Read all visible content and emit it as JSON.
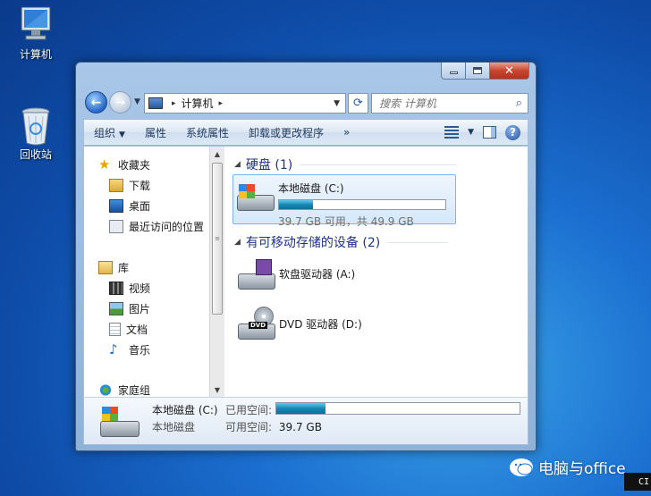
{
  "desktop": {
    "icons": [
      {
        "label": "计算机"
      },
      {
        "label": "回收站"
      }
    ]
  },
  "window": {
    "nav": {
      "back_glyph": "←",
      "forward_glyph": "→",
      "recent_glyph": "▼"
    },
    "address": {
      "path": [
        "计算机"
      ],
      "separator": "▸"
    },
    "refresh_glyph": "⟳",
    "search": {
      "placeholder": "搜索 计算机"
    },
    "toolbar": {
      "organize": "组织",
      "properties": "属性",
      "system_properties": "系统属性",
      "uninstall": "卸载或更改程序",
      "more": "»",
      "help": "?"
    },
    "nav_pane": {
      "favorites": "收藏夹",
      "downloads": "下载",
      "desktop": "桌面",
      "recent": "最近访问的位置",
      "libraries": "库",
      "videos": "视频",
      "pictures": "图片",
      "documents": "文档",
      "music": "音乐",
      "homegroup": "家庭组"
    },
    "main": {
      "hard_disks": {
        "title": "硬盘 (1)"
      },
      "removable": {
        "title": "有可移动存储的设备 (2)"
      },
      "drives": [
        {
          "name": "本地磁盘 (C:)",
          "detail": "39.7 GB 可用，共 49.9 GB",
          "used_fraction": 0.204
        },
        {
          "name": "软盘驱动器 (A:)"
        },
        {
          "name": "DVD 驱动器 (D:)"
        }
      ]
    },
    "details": {
      "name": "本地磁盘 (C:)",
      "type": "本地磁盘",
      "used_label": "已用空间:",
      "free_label": "可用空间:",
      "free_value": "39.7 GB",
      "used_fraction": 0.204
    }
  },
  "watermark": {
    "text": "电脑与office"
  },
  "corner_tag": "CI",
  "colors": {
    "desktop_bg": "#1b6fd0",
    "close_button": "#c8462e",
    "group_title": "#1e3287",
    "capacity_bar": "#1787b4"
  }
}
